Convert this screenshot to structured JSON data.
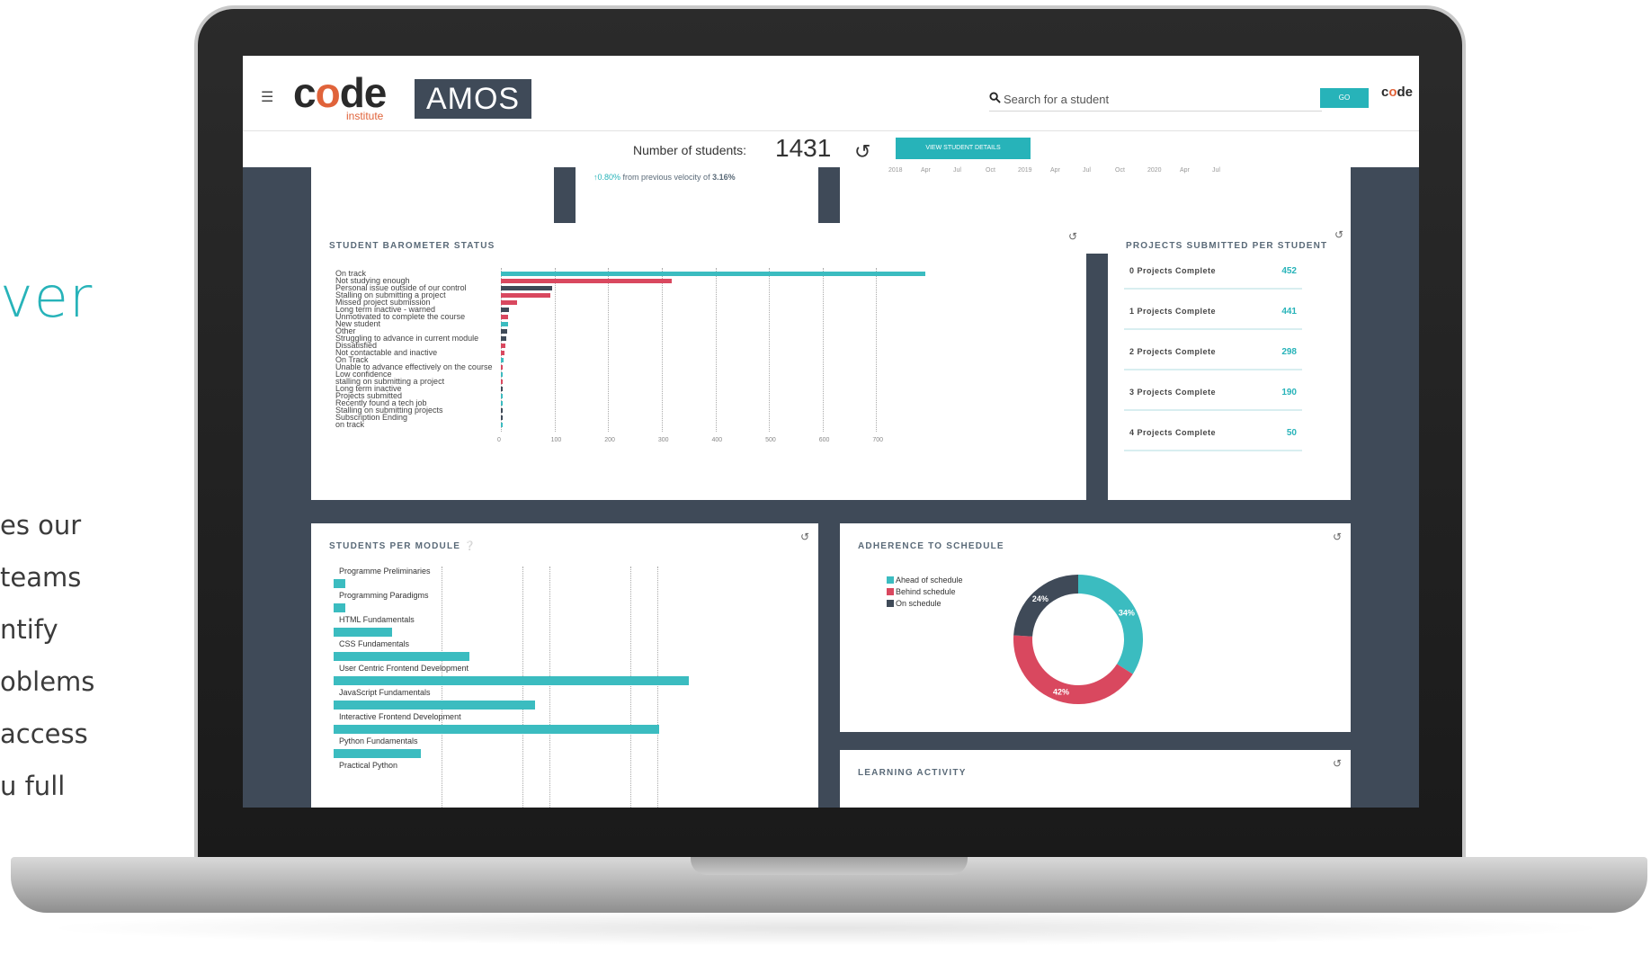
{
  "promo": {
    "heading": "ver",
    "lines": [
      "es our",
      " teams",
      "ntify",
      "oblems",
      "access",
      "u full"
    ]
  },
  "header": {
    "brand": "code",
    "brand_sub": "institute",
    "product": "AMOS",
    "search_placeholder": "Search for a student",
    "go_label": "GO",
    "mini_brand": "code",
    "num_students_label": "Number of students:",
    "num_students_value": "1431",
    "view_details_label": "VIEW STUDENT DETAILS"
  },
  "top_cards": {
    "velocity_change": "0.80%",
    "velocity_text": " from previous velocity of ",
    "velocity_prev": "3.16%",
    "timeline_ticks": [
      "2018",
      "Apr",
      "Jul",
      "Oct",
      "2019",
      "Apr",
      "Jul",
      "Oct",
      "2020",
      "Apr",
      "Jul"
    ]
  },
  "barometer": {
    "title": "STUDENT BAROMETER STATUS",
    "chart_data": {
      "type": "bar",
      "orientation": "horizontal",
      "categories": [
        "On track",
        "Not studying enough",
        "Personal issue outside of our control",
        "Stalling on submitting a project",
        "Missed project submission",
        "Long term inactive - warned",
        "Unmotivated to complete the course",
        "New student",
        "Other",
        "Struggling to advance in current module",
        "Dissatisfied",
        "Not contactable and inactive",
        "On Track",
        "Unable to advance effectively on the course",
        "Low confidence",
        "stalling on submitting a project",
        "Long term inactive",
        "Projects submitted",
        "Recently found a tech job",
        "Stalling on submitting projects",
        "Subscription Ending",
        "on track"
      ],
      "values": [
        792,
        318,
        95,
        93,
        30,
        15,
        14,
        13,
        11,
        10,
        8,
        6,
        5,
        4,
        3,
        2,
        1,
        1,
        1,
        1,
        1,
        1
      ],
      "colors": [
        "#3bbcc0",
        "#d9485f",
        "#3f4a58",
        "#d9485f",
        "#d9485f",
        "#3f4a58",
        "#d9485f",
        "#3bbcc0",
        "#3f4a58",
        "#3f4a58",
        "#d9485f",
        "#d9485f",
        "#3bbcc0",
        "#d9485f",
        "#3bbcc0",
        "#d9485f",
        "#3f4a58",
        "#3bbcc0",
        "#3bbcc0",
        "#3f4a58",
        "#3f4a58",
        "#3bbcc0"
      ],
      "xlim": [
        0,
        800
      ],
      "ticks": [
        "0",
        "100",
        "200",
        "300",
        "400",
        "500",
        "600",
        "700"
      ],
      "grid": true
    }
  },
  "projects": {
    "title": "PROJECTS SUBMITTED PER STUDENT",
    "rows": [
      {
        "label": "0 Projects Complete",
        "value": "452"
      },
      {
        "label": "1 Projects Complete",
        "value": "441"
      },
      {
        "label": "2 Projects Complete",
        "value": "298"
      },
      {
        "label": "3 Projects Complete",
        "value": "190"
      },
      {
        "label": "4 Projects Complete",
        "value": "50"
      }
    ]
  },
  "modules": {
    "title": "STUDENTS PER MODULE",
    "chart_data": {
      "type": "bar",
      "orientation": "horizontal",
      "categories": [
        "Programme Preliminaries",
        "Programming Paradigms",
        "HTML Fundamentals",
        "CSS Fundamentals",
        "User Centric Frontend Development",
        "JavaScript Fundamentals",
        "Interactive Frontend Development",
        "Python Fundamentals",
        "Practical Python"
      ],
      "values": [
        12,
        12,
        60,
        140,
        365,
        207,
        335,
        90,
        0
      ],
      "xlim": [
        0,
        430
      ],
      "grid": true
    },
    "cut_label": "Practical Python"
  },
  "adherence": {
    "title": "ADHERENCE TO SCHEDULE",
    "chart_data": {
      "type": "pie",
      "hole": true,
      "categories": [
        "Ahead of schedule",
        "Behind schedule",
        "On schedule"
      ],
      "values": [
        34,
        42,
        24
      ],
      "colors": [
        "#3bbcc0",
        "#d9485f",
        "#3f4a58"
      ],
      "labels": [
        "34%",
        "42%",
        "24%"
      ]
    }
  },
  "learning": {
    "title": "LEARNING ACTIVITY"
  }
}
